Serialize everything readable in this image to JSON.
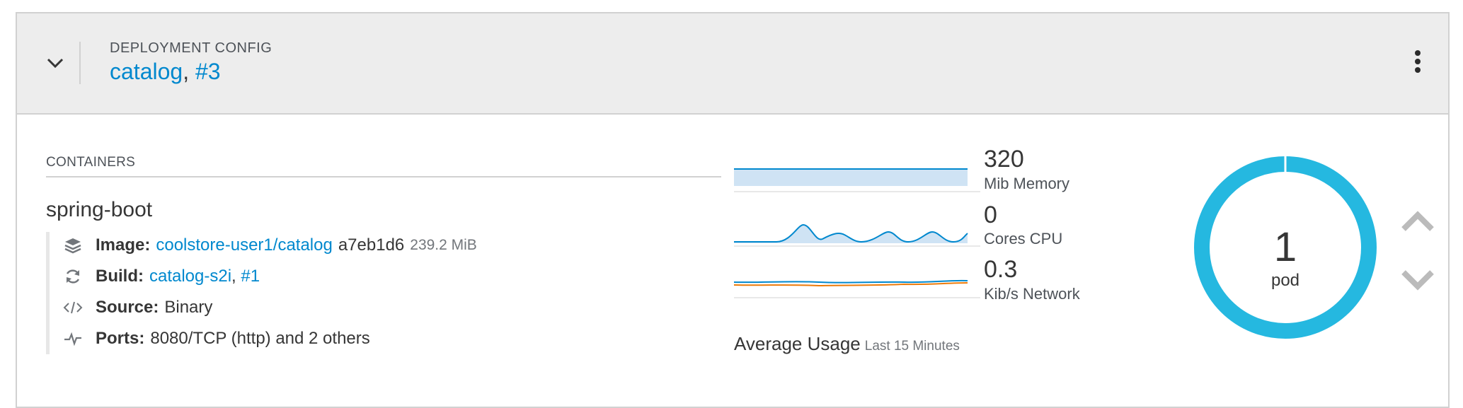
{
  "header": {
    "kind": "DEPLOYMENT CONFIG",
    "name": "catalog",
    "separator": ",",
    "revision": "#3"
  },
  "containers": {
    "heading": "CONTAINERS",
    "name": "spring-boot",
    "image": {
      "label": "Image:",
      "link": "coolstore-user1/catalog",
      "sha": "a7eb1d6",
      "size": "239.2 MiB"
    },
    "build": {
      "label": "Build:",
      "link": "catalog-s2i",
      "separator": ",",
      "number": "#1"
    },
    "source": {
      "label": "Source:",
      "value": "Binary"
    },
    "ports": {
      "label": "Ports:",
      "value": "8080/TCP (http) and 2 others"
    }
  },
  "metrics": {
    "memory": {
      "value": "320",
      "label": "Mib Memory"
    },
    "cpu": {
      "value": "0",
      "label": "Cores CPU"
    },
    "network": {
      "value": "0.3",
      "label": "Kib/s Network"
    },
    "average_label": "Average Usage",
    "range_label": "Last 15 Minutes"
  },
  "pods": {
    "count": "1",
    "label": "pod"
  },
  "colors": {
    "link": "#0088ce",
    "donut": "#25b8e0",
    "spark_line": "#0088ce",
    "spark_fill": "#cfe3f4",
    "network_orange": "#ec7a08"
  },
  "icons": {
    "collapse": "chevron-down-icon",
    "actions": "kebab-icon",
    "image": "layers-icon",
    "build": "refresh-icon",
    "source": "code-icon",
    "ports": "pulse-icon",
    "scale_up": "chevron-up-icon",
    "scale_down": "chevron-down-icon"
  }
}
